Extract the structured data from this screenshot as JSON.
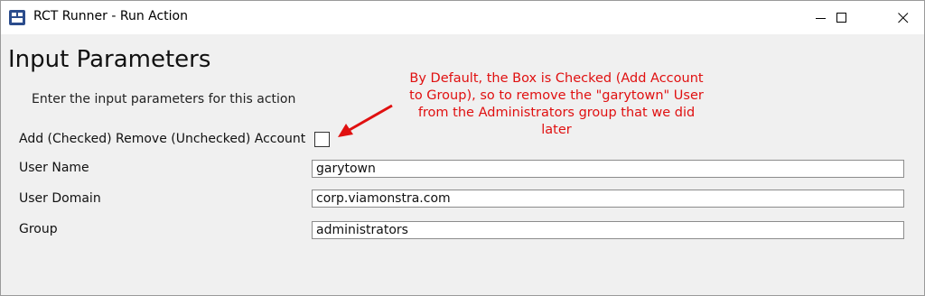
{
  "window": {
    "title": "RCT Runner - Run Action",
    "app_icon": "app-window-icon",
    "controls": [
      "minimize-icon",
      "maximize-icon",
      "close-icon"
    ]
  },
  "page": {
    "heading": "Input Parameters",
    "subtext": "Enter the input parameters for this action"
  },
  "fields": {
    "add_remove_label": "Add (Checked) Remove (Unchecked) Account",
    "add_remove_checked": false,
    "user_name_label": "User Name",
    "user_name_value": "garytown",
    "user_domain_label": "User Domain",
    "user_domain_value": "corp.viamonstra.com",
    "group_label": "Group",
    "group_value": "administrators"
  },
  "annotation": {
    "lines": [
      "By Default, the Box is Checked (Add Account",
      "to Group), so to remove the \"garytown\" User",
      "from the Administrators group that we did",
      "later"
    ],
    "color": "#e01010"
  }
}
